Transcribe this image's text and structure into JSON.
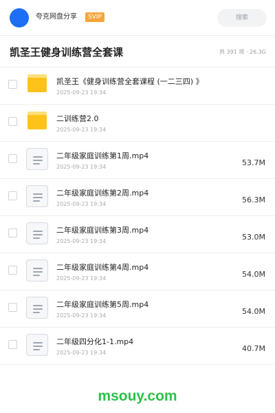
{
  "header": {
    "user_name": "夸克网盘分享",
    "badge": "SVIP",
    "search_placeholder": "搜索"
  },
  "folder": {
    "title": "凯圣王健身训练营全套课",
    "summary": "共 391 项 · 26.3G"
  },
  "files": [
    {
      "type": "folder",
      "name": "凯圣王《健身训练营全套课程 (一二三四) 》",
      "date": "2025-09-23 19:34",
      "size": ""
    },
    {
      "type": "folder",
      "name": "二训练营2.0",
      "date": "2025-09-23 19:34",
      "size": ""
    },
    {
      "type": "video",
      "name": "二年级家庭训练第1周.mp4",
      "date": "2025-09-23 19:34",
      "size": "53.7M"
    },
    {
      "type": "video",
      "name": "二年级家庭训练第2周.mp4",
      "date": "2025-09-23 19:34",
      "size": "56.3M"
    },
    {
      "type": "video",
      "name": "二年级家庭训练第3周.mp4",
      "date": "2025-09-23 19:34",
      "size": "53.0M"
    },
    {
      "type": "video",
      "name": "二年级家庭训练第4周.mp4",
      "date": "2025-09-23 19:34",
      "size": "54.0M"
    },
    {
      "type": "video",
      "name": "二年级家庭训练第5周.mp4",
      "date": "2025-09-23 19:34",
      "size": "54.0M"
    },
    {
      "type": "video",
      "name": "二年级四分化1-1.mp4",
      "date": "2025-09-23 19:34",
      "size": "40.7M"
    }
  ],
  "watermark": "msouy.com",
  "colors": {
    "avatar": "#1e6ff5",
    "badge": "#f7a53a",
    "folder": "#ffc21a",
    "watermark": "#2ec04a"
  }
}
